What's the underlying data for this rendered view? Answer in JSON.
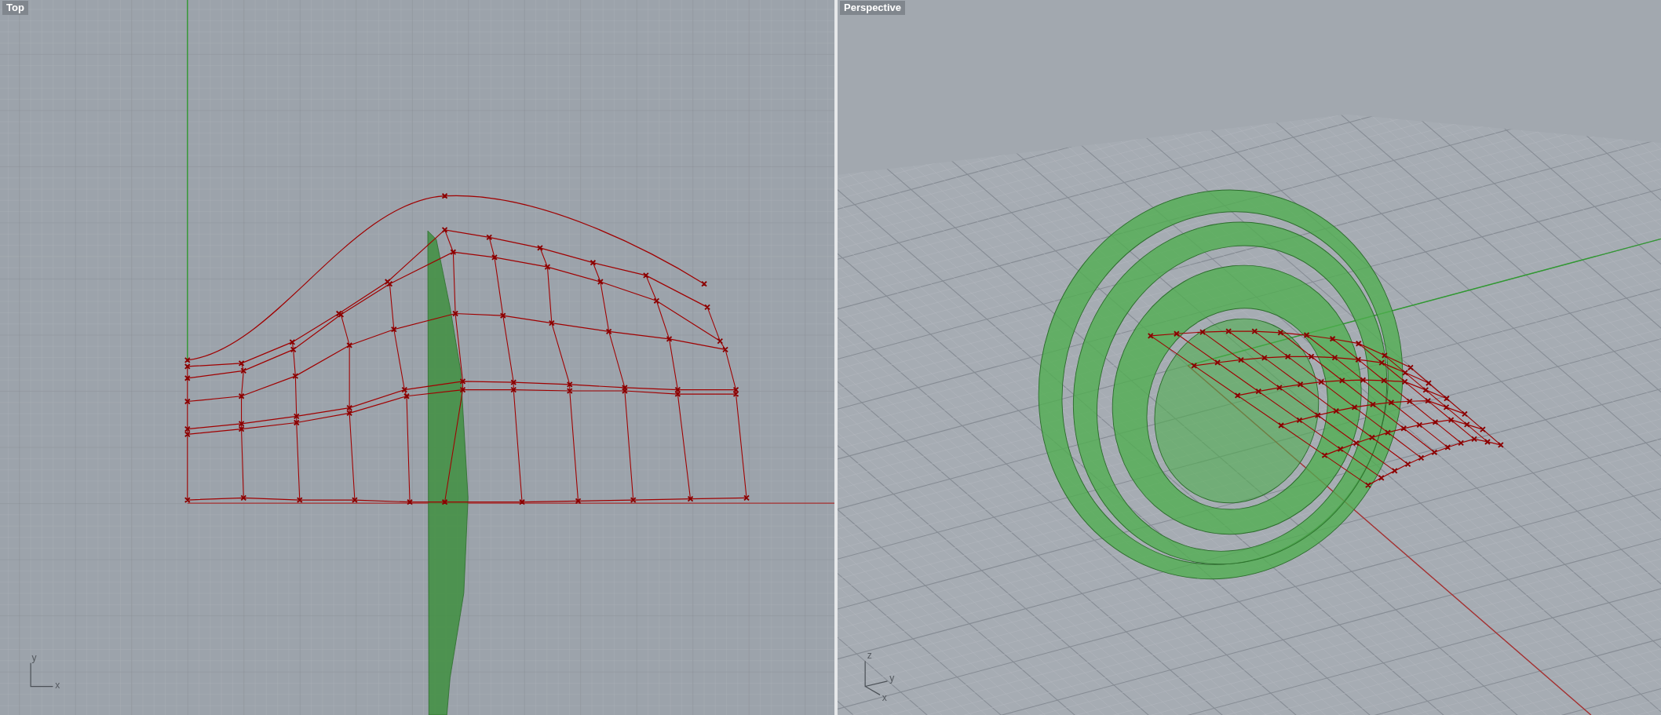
{
  "viewports": [
    {
      "title": "Top",
      "kind": "top",
      "axis_labels": [
        "y",
        "x"
      ]
    },
    {
      "title": "Perspective",
      "kind": "perspective",
      "axis_labels": [
        "z",
        "y",
        "x"
      ]
    }
  ]
}
